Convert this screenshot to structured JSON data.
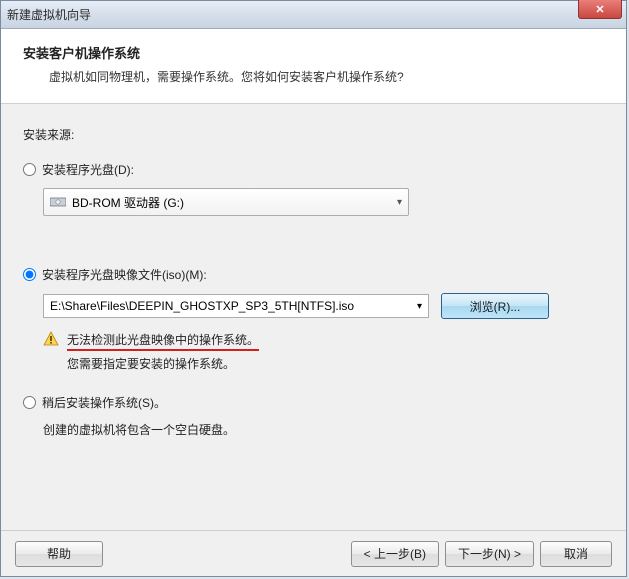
{
  "window": {
    "title": "新建虚拟机向导"
  },
  "header": {
    "title": "安装客户机操作系统",
    "subtitle": "虚拟机如同物理机，需要操作系统。您将如何安装客户机操作系统?"
  },
  "source": {
    "label": "安装来源:"
  },
  "option_disc": {
    "label": "安装程序光盘(D):",
    "combo_value": "BD-ROM 驱动器 (G:)",
    "selected": false
  },
  "option_iso": {
    "label": "安装程序光盘映像文件(iso)(M):",
    "path": "E:\\Share\\Files\\DEEPIN_GHOSTXP_SP3_5TH[NTFS].iso",
    "browse": "浏览(R)...",
    "selected": true,
    "warn_line1": "无法检测此光盘映像中的操作系统。",
    "warn_line2": "您需要指定要安装的操作系统。"
  },
  "option_later": {
    "label": "稍后安装操作系统(S)。",
    "hint": "创建的虚拟机将包含一个空白硬盘。",
    "selected": false
  },
  "footer": {
    "help": "帮助",
    "back": "< 上一步(B)",
    "next": "下一步(N) >",
    "cancel": "取消"
  }
}
